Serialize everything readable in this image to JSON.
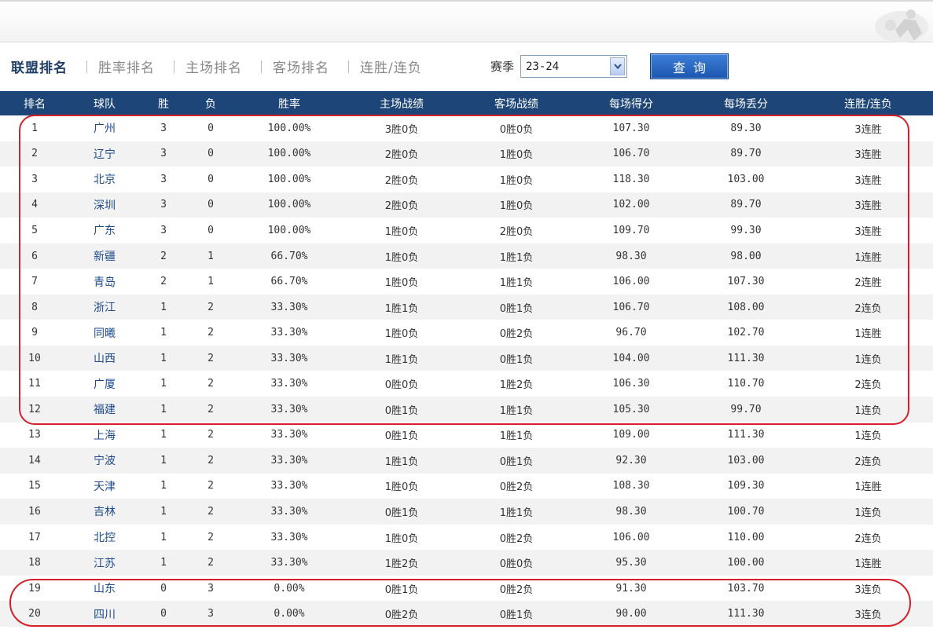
{
  "nav": {
    "tabs": [
      {
        "label": "联盟排名",
        "active": true
      },
      {
        "label": "胜率排名",
        "active": false
      },
      {
        "label": "主场排名",
        "active": false
      },
      {
        "label": "客场排名",
        "active": false
      },
      {
        "label": "连胜/连负",
        "active": false
      }
    ],
    "season_label": "赛季",
    "season_value": "23-24",
    "query_label": "查询"
  },
  "table": {
    "headers": [
      "排名",
      "球队",
      "胜",
      "负",
      "胜率",
      "主场战绩",
      "客场战绩",
      "每场得分",
      "每场丢分",
      "连胜/连负"
    ],
    "rows": [
      [
        "1",
        "广州",
        "3",
        "0",
        "100.00%",
        "3胜0负",
        "0胜0负",
        "107.30",
        "89.30",
        "3连胜"
      ],
      [
        "2",
        "辽宁",
        "3",
        "0",
        "100.00%",
        "2胜0负",
        "1胜0负",
        "106.70",
        "89.70",
        "3连胜"
      ],
      [
        "3",
        "北京",
        "3",
        "0",
        "100.00%",
        "2胜0负",
        "1胜0负",
        "118.30",
        "103.00",
        "3连胜"
      ],
      [
        "4",
        "深圳",
        "3",
        "0",
        "100.00%",
        "2胜0负",
        "1胜0负",
        "102.00",
        "89.70",
        "3连胜"
      ],
      [
        "5",
        "广东",
        "3",
        "0",
        "100.00%",
        "1胜0负",
        "2胜0负",
        "109.70",
        "99.30",
        "3连胜"
      ],
      [
        "6",
        "新疆",
        "2",
        "1",
        "66.70%",
        "1胜0负",
        "1胜1负",
        "98.30",
        "98.00",
        "1连胜"
      ],
      [
        "7",
        "青岛",
        "2",
        "1",
        "66.70%",
        "1胜0负",
        "1胜1负",
        "106.00",
        "107.30",
        "2连胜"
      ],
      [
        "8",
        "浙江",
        "1",
        "2",
        "33.30%",
        "1胜1负",
        "0胜1负",
        "106.70",
        "108.00",
        "2连负"
      ],
      [
        "9",
        "同曦",
        "1",
        "2",
        "33.30%",
        "1胜0负",
        "0胜2负",
        "96.70",
        "102.70",
        "1连胜"
      ],
      [
        "10",
        "山西",
        "1",
        "2",
        "33.30%",
        "1胜1负",
        "0胜1负",
        "104.00",
        "111.30",
        "1连负"
      ],
      [
        "11",
        "广厦",
        "1",
        "2",
        "33.30%",
        "0胜0负",
        "1胜2负",
        "106.30",
        "110.70",
        "2连负"
      ],
      [
        "12",
        "福建",
        "1",
        "2",
        "33.30%",
        "0胜1负",
        "1胜1负",
        "105.30",
        "99.70",
        "1连负"
      ],
      [
        "13",
        "上海",
        "1",
        "2",
        "33.30%",
        "0胜1负",
        "1胜1负",
        "109.00",
        "111.30",
        "1连负"
      ],
      [
        "14",
        "宁波",
        "1",
        "2",
        "33.30%",
        "1胜1负",
        "0胜1负",
        "92.30",
        "103.00",
        "2连负"
      ],
      [
        "15",
        "天津",
        "1",
        "2",
        "33.30%",
        "1胜0负",
        "0胜2负",
        "108.30",
        "109.30",
        "1连胜"
      ],
      [
        "16",
        "吉林",
        "1",
        "2",
        "33.30%",
        "0胜1负",
        "1胜1负",
        "98.30",
        "100.70",
        "1连负"
      ],
      [
        "17",
        "北控",
        "1",
        "2",
        "33.30%",
        "1胜0负",
        "0胜2负",
        "106.00",
        "110.00",
        "2连负"
      ],
      [
        "18",
        "江苏",
        "1",
        "2",
        "33.30%",
        "1胜2负",
        "0胜0负",
        "95.30",
        "100.00",
        "1连胜"
      ],
      [
        "19",
        "山东",
        "0",
        "3",
        "0.00%",
        "0胜1负",
        "0胜2负",
        "91.30",
        "103.70",
        "3连负"
      ],
      [
        "20",
        "四川",
        "0",
        "3",
        "0.00%",
        "0胜2负",
        "0胜1负",
        "90.00",
        "111.30",
        "3连负"
      ]
    ]
  },
  "colors": {
    "header_bg": "#1d4577",
    "team_link": "#1e4b8c",
    "highlight": "#d4202a",
    "button": "#1c56ae"
  }
}
